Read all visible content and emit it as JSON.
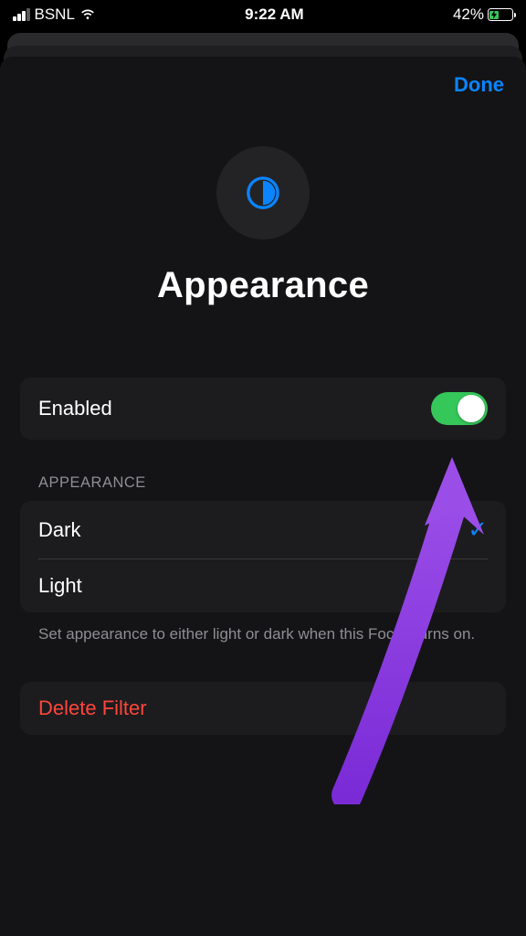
{
  "status": {
    "carrier": "BSNL",
    "time": "9:22 AM",
    "battery_pct": "42%",
    "battery_fill": 42
  },
  "sheet": {
    "done": "Done",
    "hero_title": "Appearance",
    "enabled_label": "Enabled",
    "enabled": true,
    "section_header": "APPEARANCE",
    "options": [
      {
        "label": "Dark",
        "selected": true
      },
      {
        "label": "Light",
        "selected": false
      }
    ],
    "footer": "Set appearance to either light or dark when this Focus turns on.",
    "delete_label": "Delete Filter"
  }
}
